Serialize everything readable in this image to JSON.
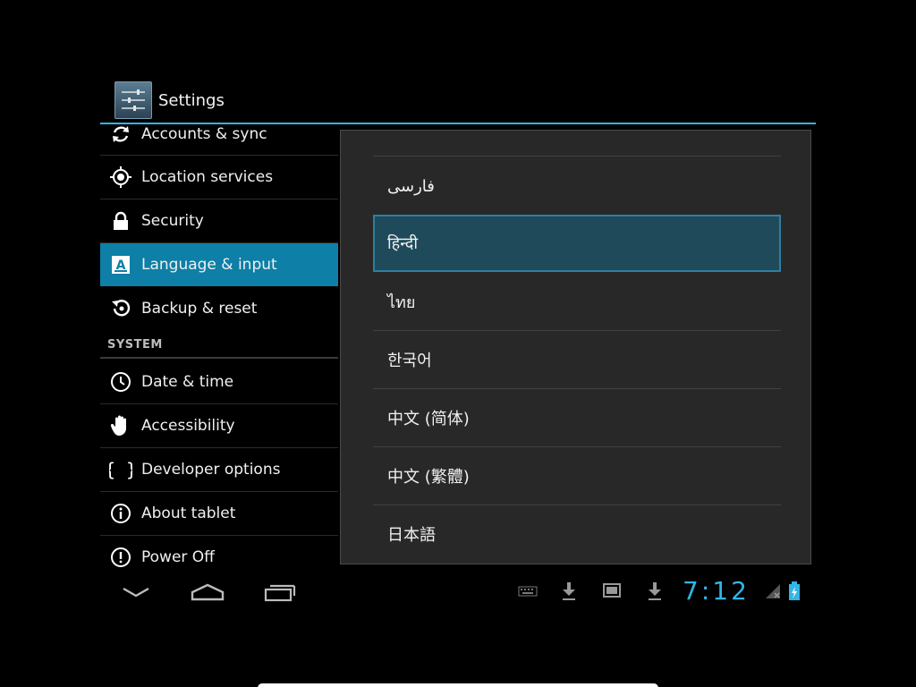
{
  "action_bar": {
    "title": "Settings"
  },
  "settings": {
    "items": [
      {
        "label": "Accounts & sync",
        "icon": "sync-icon"
      },
      {
        "label": "Location services",
        "icon": "location-icon"
      },
      {
        "label": "Security",
        "icon": "lock-icon"
      },
      {
        "label": "Language & input",
        "icon": "language-icon"
      },
      {
        "label": "Backup & reset",
        "icon": "backup-icon"
      }
    ],
    "system_header": "SYSTEM",
    "system_items": [
      {
        "label": "Date & time",
        "icon": "clock-icon"
      },
      {
        "label": "Accessibility",
        "icon": "hand-icon"
      },
      {
        "label": "Developer options",
        "icon": "braces-icon"
      },
      {
        "label": "About tablet",
        "icon": "info-icon"
      },
      {
        "label": "Power Off",
        "icon": "power-icon"
      }
    ]
  },
  "language_dialog": {
    "items": [
      {
        "label": "فارسی"
      },
      {
        "label": "हिन्दी"
      },
      {
        "label": "ไทย"
      },
      {
        "label": "한국어"
      },
      {
        "label": "中文 (简体)"
      },
      {
        "label": "中文 (繁體)"
      },
      {
        "label": "日本語"
      }
    ],
    "selected": "हिन्दी"
  },
  "status_bar": {
    "time": "7:12"
  },
  "colors": {
    "accent": "#33b5e5",
    "selected_item": "#0e7fa6",
    "dialog_selected": "#1f4a5a"
  }
}
